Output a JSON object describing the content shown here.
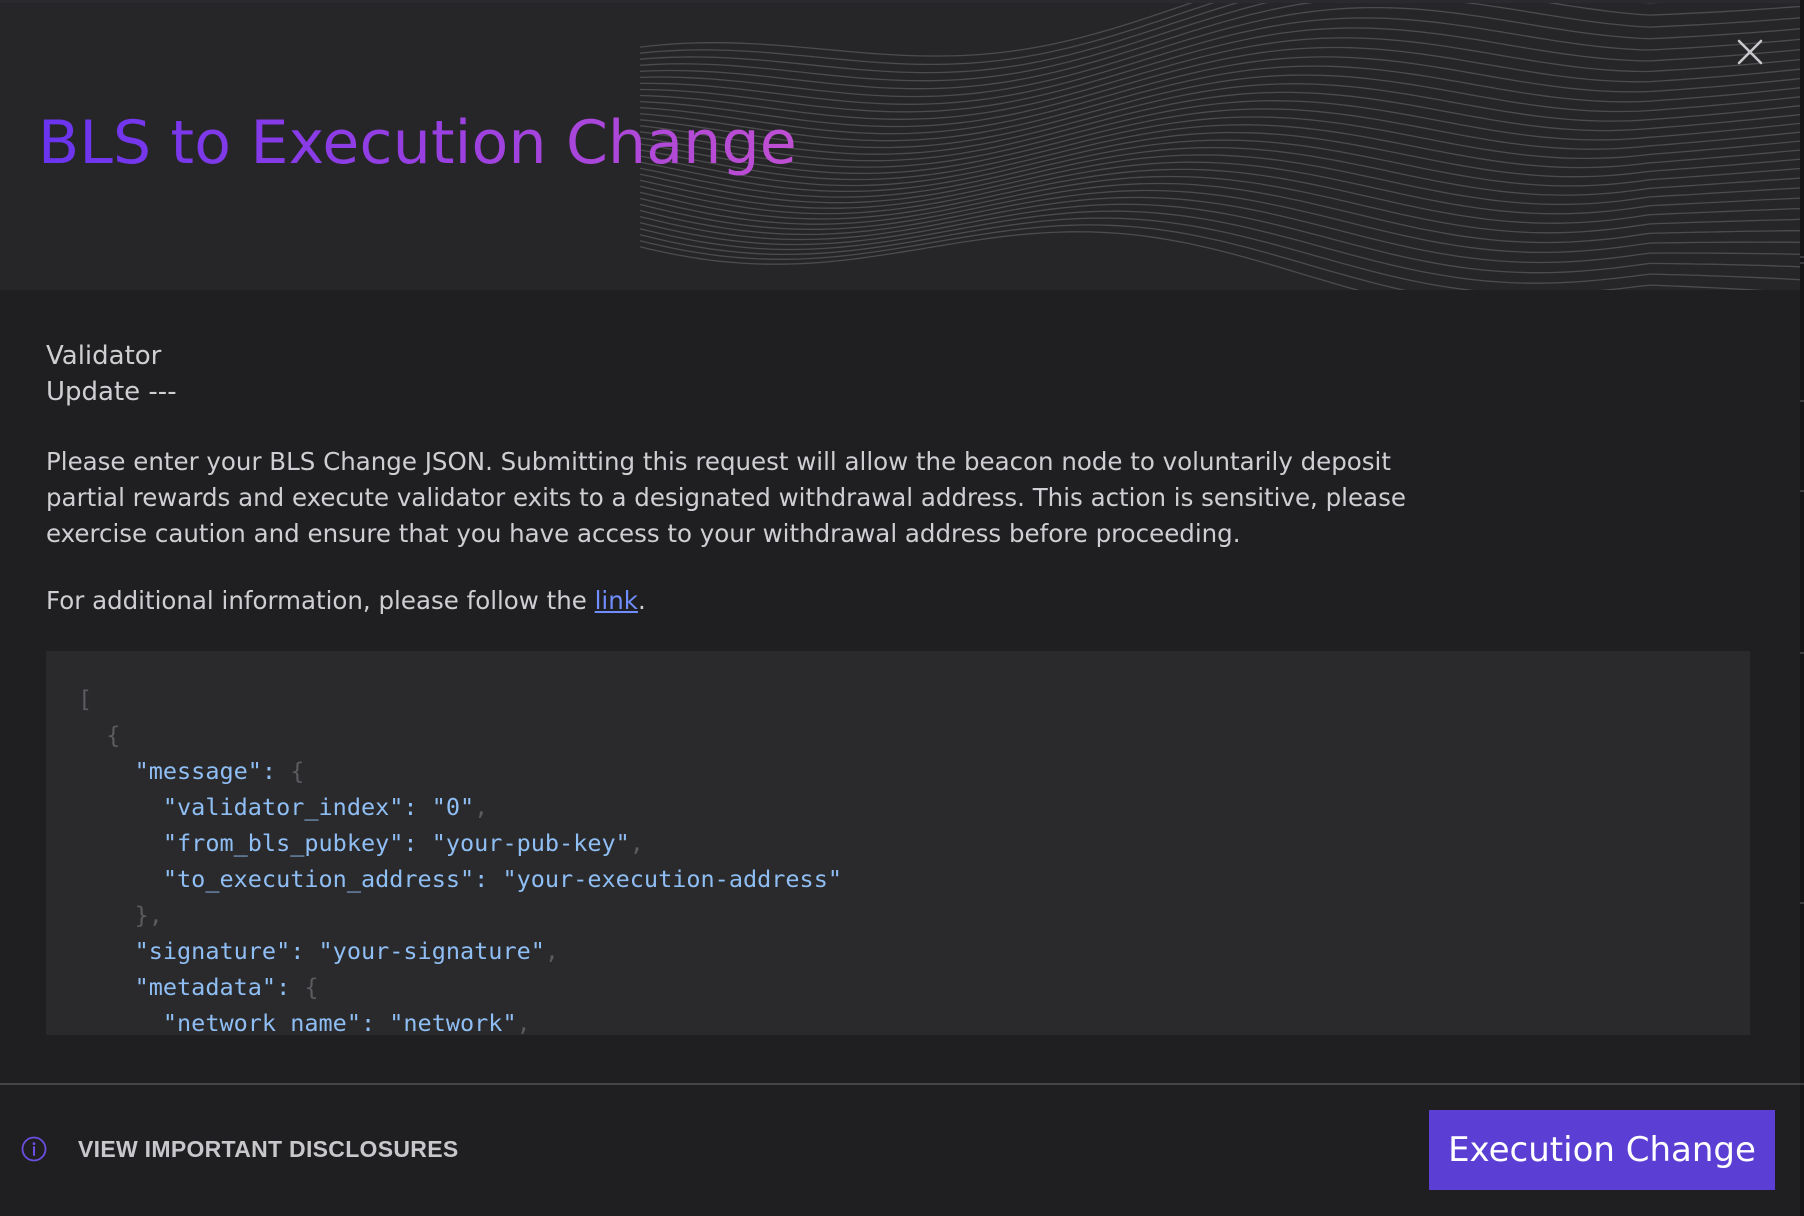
{
  "modal": {
    "title": "BLS to Execution Change",
    "close_icon": "close-icon"
  },
  "body": {
    "validator_label": "Validator",
    "update_label": "Update ---",
    "description": "Please enter your BLS Change JSON. Submitting this request will allow the beacon node to voluntarily deposit partial rewards and execute validator exits to a designated withdrawal address. This action is sensitive, please exercise caution and ensure that you have access to your withdrawal address before proceeding.",
    "info_prefix": "For additional information, please follow the ",
    "info_link": "link",
    "info_suffix": "."
  },
  "code": {
    "lines": {
      "l0": {
        "punct": "["
      },
      "l1": {
        "punct": "{"
      },
      "l2": {
        "key": "\"message\": ",
        "punct": "{"
      },
      "l3": {
        "key": "\"validator_index\": \"0\"",
        "punct": ","
      },
      "l4": {
        "key": "\"from_bls_pubkey\": \"your-pub-key\"",
        "punct": ","
      },
      "l5": {
        "key": "\"to_execution_address\": \"your-execution-address\""
      },
      "l6": {
        "punct": "},"
      },
      "l7": {
        "key": "\"signature\": \"your-signature\"",
        "punct": ","
      },
      "l8": {
        "key": "\"metadata\": ",
        "punct": "{"
      },
      "l9": {
        "key": "\"network_name\": \"network\"",
        "punct": ","
      }
    }
  },
  "footer": {
    "disclosures_label": "VIEW IMPORTANT DISCLOSURES",
    "disclosures_icon": "info-icon",
    "primary_button": "Execution Change"
  },
  "colors": {
    "title_gradient_start": "#6a34f0",
    "title_gradient_end": "#c04fd2",
    "primary_button": "#5b3fd4",
    "link": "#6f8dfc",
    "code_key": "#8fbef4",
    "code_punct": "#5b5b60"
  }
}
